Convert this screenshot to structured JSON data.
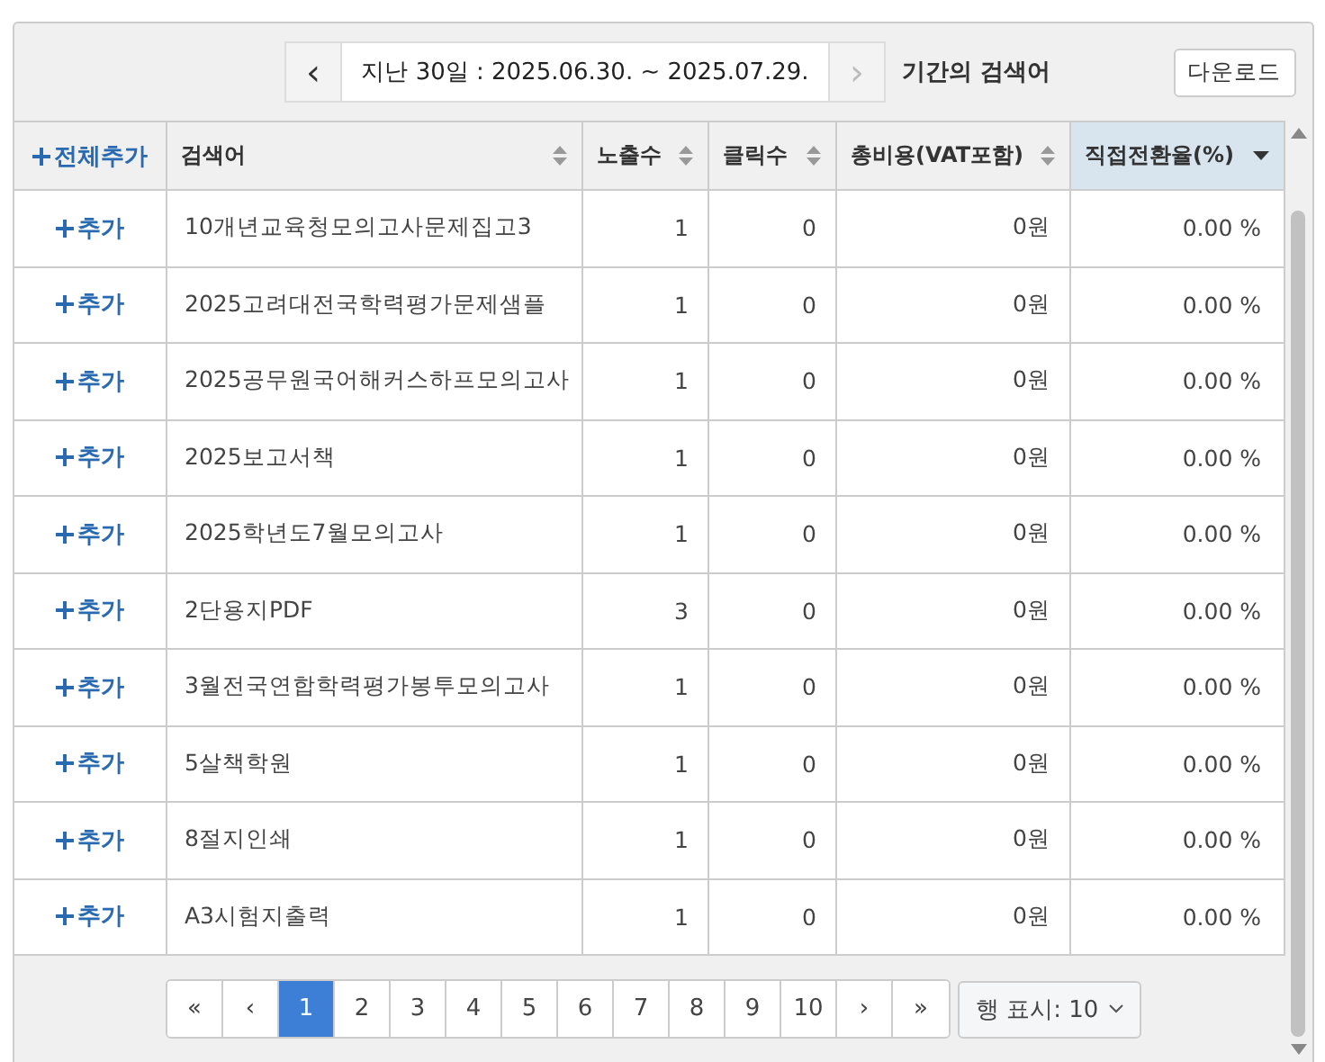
{
  "period_nav": {
    "prev": "‹",
    "range": "지난 30일 : 2025.06.30. ~ 2025.07.29.",
    "next": "›",
    "next_disabled": true,
    "caption": "기간의 검색어"
  },
  "download_button": "다운로드",
  "table": {
    "add_all": "전체추가",
    "columns": [
      {
        "label": "검색어",
        "sorted": false
      },
      {
        "label": "노출수",
        "sorted": false
      },
      {
        "label": "클릭수",
        "sorted": false
      },
      {
        "label": "총비용(VAT포함)",
        "sorted": false
      },
      {
        "label": "직접전환율(%)",
        "sorted": true
      }
    ],
    "rows": [
      {
        "add": "추가",
        "keyword": "10개년교육청모의고사문제집고3",
        "impressions": "1",
        "clicks": "0",
        "cost": "0원",
        "conversion": "0.00 %"
      },
      {
        "add": "추가",
        "keyword": "2025고려대전국학력평가문제샘플",
        "impressions": "1",
        "clicks": "0",
        "cost": "0원",
        "conversion": "0.00 %"
      },
      {
        "add": "추가",
        "keyword": "2025공무원국어해커스하프모의고사",
        "impressions": "1",
        "clicks": "0",
        "cost": "0원",
        "conversion": "0.00 %"
      },
      {
        "add": "추가",
        "keyword": "2025보고서책",
        "impressions": "1",
        "clicks": "0",
        "cost": "0원",
        "conversion": "0.00 %"
      },
      {
        "add": "추가",
        "keyword": "2025학년도7월모의고사",
        "impressions": "1",
        "clicks": "0",
        "cost": "0원",
        "conversion": "0.00 %"
      },
      {
        "add": "추가",
        "keyword": "2단용지PDF",
        "impressions": "3",
        "clicks": "0",
        "cost": "0원",
        "conversion": "0.00 %"
      },
      {
        "add": "추가",
        "keyword": "3월전국연합학력평가봉투모의고사",
        "impressions": "1",
        "clicks": "0",
        "cost": "0원",
        "conversion": "0.00 %"
      },
      {
        "add": "추가",
        "keyword": "5살책학원",
        "impressions": "1",
        "clicks": "0",
        "cost": "0원",
        "conversion": "0.00 %"
      },
      {
        "add": "추가",
        "keyword": "8절지인쇄",
        "impressions": "1",
        "clicks": "0",
        "cost": "0원",
        "conversion": "0.00 %"
      },
      {
        "add": "추가",
        "keyword": "A3시험지출력",
        "impressions": "1",
        "clicks": "0",
        "cost": "0원",
        "conversion": "0.00 %"
      }
    ]
  },
  "pagination": {
    "first": "«",
    "prev": "‹",
    "pages": [
      {
        "label": "1",
        "selected": true
      },
      {
        "label": "2",
        "selected": false
      },
      {
        "label": "3",
        "selected": false
      },
      {
        "label": "4",
        "selected": false
      },
      {
        "label": "5",
        "selected": false
      },
      {
        "label": "6",
        "selected": false
      },
      {
        "label": "7",
        "selected": false
      },
      {
        "label": "8",
        "selected": false
      },
      {
        "label": "9",
        "selected": false
      },
      {
        "label": "10",
        "selected": false
      }
    ],
    "next": "›",
    "last": "»",
    "rows_select": "행 표시: 10"
  }
}
